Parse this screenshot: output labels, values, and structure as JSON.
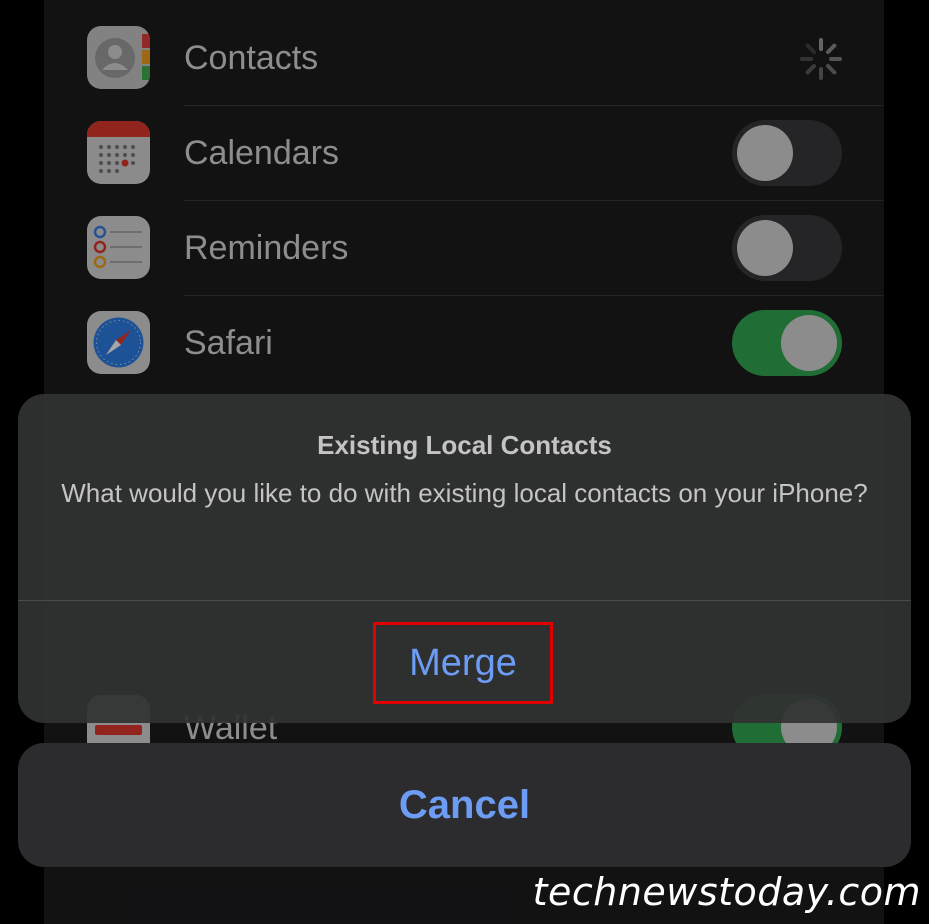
{
  "apps": [
    {
      "label": "Contacts",
      "icon": "contacts-icon",
      "state": "loading"
    },
    {
      "label": "Calendars",
      "icon": "calendar-icon",
      "state": "off"
    },
    {
      "label": "Reminders",
      "icon": "reminders-icon",
      "state": "off"
    },
    {
      "label": "Safari",
      "icon": "safari-icon",
      "state": "on"
    },
    {
      "label": "Wallet",
      "icon": "wallet-icon",
      "state": "on"
    }
  ],
  "alert": {
    "title": "Existing Local Contacts",
    "message": "What would you like to do with existing local contacts on your iPhone?",
    "merge_label": "Merge",
    "cancel_label": "Cancel"
  },
  "watermark": "technewstoday.com",
  "colors": {
    "accent": "#6d9cf4",
    "toggle_on": "#34a853",
    "highlight_box": "#e00000"
  }
}
